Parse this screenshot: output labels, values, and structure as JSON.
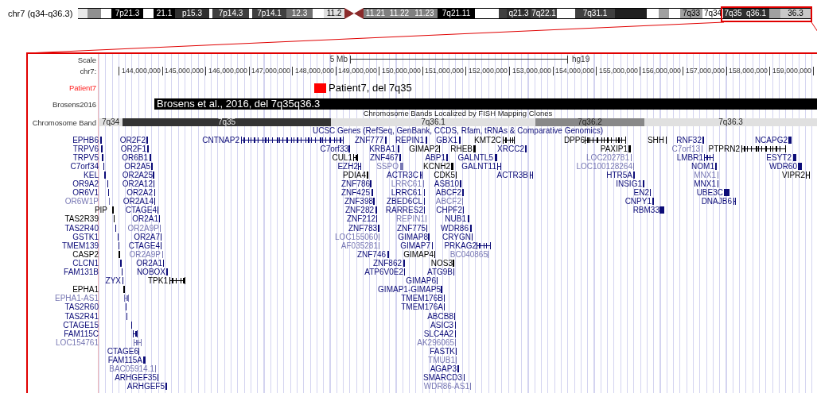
{
  "ideogram": {
    "title": "chr7 (q34-q36.3)",
    "bands": [
      {
        "kind": "band",
        "color": "#e8e8e8"
      },
      {
        "kind": "band",
        "color": "#909090"
      },
      {
        "kind": "band",
        "color": "#ffffff"
      },
      {
        "kind": "band",
        "label": "7p21.3",
        "color": "#000000"
      },
      {
        "kind": "band",
        "color": "#ffffff"
      },
      {
        "kind": "band",
        "label": "21.1",
        "color": "#000000"
      },
      {
        "kind": "band",
        "label": "p15.3",
        "color": "#303030"
      },
      {
        "kind": "band",
        "color": "#ffffff"
      },
      {
        "kind": "band",
        "label": "7p14.3",
        "color": "#404040"
      },
      {
        "kind": "band",
        "color": "#ffffff"
      },
      {
        "kind": "band",
        "label": "7p14.1",
        "color": "#404040"
      },
      {
        "kind": "band",
        "label": "12.3",
        "color": "#707070"
      },
      {
        "kind": "band",
        "color": "#ffffff"
      },
      {
        "kind": "band",
        "label": "11.2",
        "color": "#e0e0e0"
      },
      {
        "kind": "centromere",
        "color": "#8b2a2a"
      },
      {
        "kind": "band",
        "label": "11.21",
        "color": "#808080"
      },
      {
        "kind": "band",
        "label": "11.22",
        "color": "#808080"
      },
      {
        "kind": "band",
        "label": "11.23",
        "color": "#808080"
      },
      {
        "kind": "band",
        "label": "7q21.11",
        "color": "#000000"
      },
      {
        "kind": "band",
        "color": "#ffffff"
      },
      {
        "kind": "band",
        "color": "#404040"
      },
      {
        "kind": "band",
        "label": "q21.3",
        "color": "#303030"
      },
      {
        "kind": "band",
        "label": "7q22.1",
        "color": "#404040"
      },
      {
        "kind": "band",
        "color": "#ffffff"
      },
      {
        "kind": "band",
        "label": "7q31.1",
        "color": "#404040"
      },
      {
        "kind": "band",
        "color": "#202020"
      },
      {
        "kind": "band",
        "color": "#ffffff"
      },
      {
        "kind": "band",
        "color": "#a0a0a0"
      },
      {
        "kind": "band",
        "color": "#ffffff"
      },
      {
        "kind": "band",
        "label": "7q33",
        "color": "#a0a0a0"
      },
      {
        "kind": "band",
        "label": "7q34",
        "color": "#ffffff"
      },
      {
        "kind": "band",
        "label": "7q35",
        "color": "#303030"
      },
      {
        "kind": "band",
        "label": "q36.1",
        "color": "#303030"
      },
      {
        "kind": "band",
        "color": "#a0a0a0"
      },
      {
        "kind": "band",
        "label": "36.3",
        "color": "#c8c8c8"
      }
    ]
  },
  "scale": {
    "label": "Scale",
    "bar_label": "5 Mb",
    "assembly": "hg19"
  },
  "ruler": {
    "label": "chr7:",
    "ticks": [
      "144,000,000",
      "145,000,000",
      "146,000,000",
      "147,000,000",
      "148,000,000",
      "149,000,000",
      "150,000,000",
      "151,000,000",
      "152,000,000",
      "153,000,000",
      "154,000,000",
      "155,000,000",
      "156,000,000",
      "157,000,000",
      "158,000,000",
      "159,000,000"
    ]
  },
  "patient_track": {
    "label": "Patient7",
    "item": "Patient7, del 7q35"
  },
  "brosens_track": {
    "label": "Brosens2016",
    "item": "Brosens et al., 2016, del 7q35q36.3"
  },
  "band_track": {
    "title": "Chromosome Bands Localized by FISH Mapping Clones",
    "label": "Chromosome Band",
    "bands": [
      {
        "label": "7q34",
        "color": "#e0e0e0"
      },
      {
        "label": "7q35",
        "color": "#333333"
      },
      {
        "label": "7q36.1",
        "color": "#e0e0e0"
      },
      {
        "label": "7q36.2",
        "color": "#888888"
      },
      {
        "label": "7q36.3",
        "color": "#e0e0e0"
      }
    ]
  },
  "gene_track": {
    "title": "UCSC Genes (RefSeq, GenBank, CCDS, Rfam, tRNAs & Comparative Genomics)",
    "genes": [
      {
        "name": "EPHB6",
        "color": "#0c0c78"
      },
      {
        "name": "OR2F2",
        "color": "#0c0c78"
      },
      {
        "name": "CNTNAP2",
        "color": "#0c0c78"
      },
      {
        "name": "ZNF777",
        "color": "#0c0c78"
      },
      {
        "name": "REPIN1",
        "color": "#0c0c78"
      },
      {
        "name": "GBX1",
        "color": "#0c0c78"
      },
      {
        "name": "KMT2C",
        "color": "#000000"
      },
      {
        "name": "DPP6",
        "color": "#000000"
      },
      {
        "name": "SHH",
        "color": "#000000"
      },
      {
        "name": "RNF32",
        "color": "#0c0c78"
      },
      {
        "name": "NCAPG2",
        "color": "#0c0c78"
      },
      {
        "name": "TRPV6",
        "color": "#0c0c78"
      },
      {
        "name": "OR2F1",
        "color": "#0c0c78"
      },
      {
        "name": "C7orf33",
        "color": "#0c0c78"
      },
      {
        "name": "KRBA1",
        "color": "#0c0c78"
      },
      {
        "name": "GIMAP2",
        "color": "#000000"
      },
      {
        "name": "RHEB",
        "color": "#000000"
      },
      {
        "name": "XRCC2",
        "color": "#0c0c78"
      },
      {
        "name": "PAXIP1",
        "color": "#000000"
      },
      {
        "name": "C7orf13",
        "color": "#7878b4"
      },
      {
        "name": "PTPRN2",
        "color": "#000000"
      },
      {
        "name": "TRPV5",
        "color": "#0c0c78"
      },
      {
        "name": "OR6B1",
        "color": "#0c0c78"
      },
      {
        "name": "CUL1",
        "color": "#000000"
      },
      {
        "name": "ZNF467",
        "color": "#0c0c78"
      },
      {
        "name": "ABP1",
        "color": "#0c0c78"
      },
      {
        "name": "GALNTL5",
        "color": "#0c0c78"
      },
      {
        "name": "LOC202781",
        "color": "#7878b4"
      },
      {
        "name": "LMBR1",
        "color": "#0c0c78"
      },
      {
        "name": "ESYT2",
        "color": "#0c0c78"
      },
      {
        "name": "C7orf34",
        "color": "#0c0c78"
      },
      {
        "name": "OR2A5",
        "color": "#0c0c78"
      },
      {
        "name": "EZH2",
        "color": "#0c0c78"
      },
      {
        "name": "SSPO",
        "color": "#7878b4"
      },
      {
        "name": "KCNH2",
        "color": "#000000"
      },
      {
        "name": "GALNT11",
        "color": "#0c0c78"
      },
      {
        "name": "LOC100128264",
        "color": "#7878b4"
      },
      {
        "name": "NOM1",
        "color": "#0c0c78"
      },
      {
        "name": "WDR60",
        "color": "#0c0c78"
      },
      {
        "name": "KEL",
        "color": "#0c0c78"
      },
      {
        "name": "OR2A25",
        "color": "#0c0c78"
      },
      {
        "name": "PDIA4",
        "color": "#000000"
      },
      {
        "name": "ACTR3C",
        "color": "#0c0c78"
      },
      {
        "name": "CDK5",
        "color": "#000000"
      },
      {
        "name": "ACTR3B",
        "color": "#0c0c78"
      },
      {
        "name": "HTR5A",
        "color": "#0c0c78"
      },
      {
        "name": "MNX1",
        "color": "#7878b4"
      },
      {
        "name": "VIPR2",
        "color": "#000000"
      },
      {
        "name": "OR9A2",
        "color": "#0c0c78"
      },
      {
        "name": "OR2A12",
        "color": "#0c0c78"
      },
      {
        "name": "ZNF786",
        "color": "#0c0c78"
      },
      {
        "name": "LRRC61",
        "color": "#7878b4"
      },
      {
        "name": "ASB10",
        "color": "#0c0c78"
      },
      {
        "name": "INSIG1",
        "color": "#0c0c78"
      },
      {
        "name": "MNX1",
        "color": "#0c0c78"
      },
      {
        "name": "OR6V1",
        "color": "#0c0c78"
      },
      {
        "name": "OR2A2",
        "color": "#0c0c78"
      },
      {
        "name": "ZNF425",
        "color": "#0c0c78"
      },
      {
        "name": "LRRC61",
        "color": "#0c0c78"
      },
      {
        "name": "ABCF2",
        "color": "#0c0c78"
      },
      {
        "name": "EN2",
        "color": "#0c0c78"
      },
      {
        "name": "UBE3C",
        "color": "#0c0c78"
      },
      {
        "name": "OR6W1P",
        "color": "#7878b4"
      },
      {
        "name": "OR2A14",
        "color": "#0c0c78"
      },
      {
        "name": "ZNF398",
        "color": "#0c0c78"
      },
      {
        "name": "ZBED6CL",
        "color": "#0c0c78"
      },
      {
        "name": "ABCF2",
        "color": "#7878b4"
      },
      {
        "name": "CNPY1",
        "color": "#0c0c78"
      },
      {
        "name": "DNAJB6",
        "color": "#0c0c78"
      },
      {
        "name": "PIP",
        "color": "#000000"
      },
      {
        "name": "CTAGE4",
        "color": "#0c0c78"
      },
      {
        "name": "ZNF282",
        "color": "#0c0c78"
      },
      {
        "name": "RARRES2",
        "color": "#0c0c78"
      },
      {
        "name": "CHPF2",
        "color": "#0c0c78"
      },
      {
        "name": "RBM33",
        "color": "#0c0c78"
      },
      {
        "name": "TAS2R39",
        "color": "#000000"
      },
      {
        "name": "OR2A1",
        "color": "#0c0c78"
      },
      {
        "name": "ZNF212",
        "color": "#0c0c78"
      },
      {
        "name": "REPIN1",
        "color": "#7878b4"
      },
      {
        "name": "NUB1",
        "color": "#0c0c78"
      },
      {
        "name": "TAS2R40",
        "color": "#0c0c78"
      },
      {
        "name": "OR2A9P",
        "color": "#7878b4"
      },
      {
        "name": "ZNF783",
        "color": "#0c0c78"
      },
      {
        "name": "ZNF775",
        "color": "#0c0c78"
      },
      {
        "name": "WDR86",
        "color": "#0c0c78"
      },
      {
        "name": "GSTK1",
        "color": "#0c0c78"
      },
      {
        "name": "OR2A7",
        "color": "#0c0c78"
      },
      {
        "name": "LOC155060",
        "color": "#7878b4"
      },
      {
        "name": "GIMAP8",
        "color": "#0c0c78"
      },
      {
        "name": "CRYGN",
        "color": "#0c0c78"
      },
      {
        "name": "TMEM139",
        "color": "#0c0c78"
      },
      {
        "name": "CTAGE4",
        "color": "#0c0c78"
      },
      {
        "name": "AF035281",
        "color": "#7878b4"
      },
      {
        "name": "GIMAP7",
        "color": "#0c0c78"
      },
      {
        "name": "PRKAG2",
        "color": "#0c0c78"
      },
      {
        "name": "CASP2",
        "color": "#000000"
      },
      {
        "name": "OR2A9P",
        "color": "#7878b4"
      },
      {
        "name": "ZNF746",
        "color": "#0c0c78"
      },
      {
        "name": "GIMAP4",
        "color": "#000000"
      },
      {
        "name": "BC040865",
        "color": "#7878b4"
      },
      {
        "name": "CLCN1",
        "color": "#0c0c78"
      },
      {
        "name": "OR2A1",
        "color": "#0c0c78"
      },
      {
        "name": "ZNF862",
        "color": "#0c0c78"
      },
      {
        "name": "NOS3",
        "color": "#000000"
      },
      {
        "name": "FAM131B",
        "color": "#0c0c78"
      },
      {
        "name": "NOBOX",
        "color": "#0c0c78"
      },
      {
        "name": "ATP6V0E2",
        "color": "#0c0c78"
      },
      {
        "name": "ATG9B",
        "color": "#0c0c78"
      },
      {
        "name": "ZYX",
        "color": "#0c0c78"
      },
      {
        "name": "TPK1",
        "color": "#000000"
      },
      {
        "name": "GIMAP6",
        "color": "#0c0c78"
      },
      {
        "name": "EPHA1",
        "color": "#000000"
      },
      {
        "name": "GIMAP1-GIMAP5",
        "color": "#0c0c78"
      },
      {
        "name": "EPHA1-AS1",
        "color": "#7878b4"
      },
      {
        "name": "TMEM176B",
        "color": "#0c0c78"
      },
      {
        "name": "TAS2R60",
        "color": "#0c0c78"
      },
      {
        "name": "TMEM176A",
        "color": "#0c0c78"
      },
      {
        "name": "TAS2R41",
        "color": "#0c0c78"
      },
      {
        "name": "ABCB8",
        "color": "#0c0c78"
      },
      {
        "name": "CTAGE15",
        "color": "#0c0c78"
      },
      {
        "name": "ASIC3",
        "color": "#0c0c78"
      },
      {
        "name": "FAM115C",
        "color": "#0c0c78"
      },
      {
        "name": "SLC4A2",
        "color": "#0c0c78"
      },
      {
        "name": "LOC154761",
        "color": "#7878b4"
      },
      {
        "name": "AK296065",
        "color": "#7878b4"
      },
      {
        "name": "CTAGE6",
        "color": "#0c0c78"
      },
      {
        "name": "FASTK",
        "color": "#0c0c78"
      },
      {
        "name": "FAM115A",
        "color": "#0c0c78"
      },
      {
        "name": "TMUB1",
        "color": "#7878b4"
      },
      {
        "name": "BAC05914.1",
        "color": "#7878b4"
      },
      {
        "name": "AGAP3",
        "color": "#0c0c78"
      },
      {
        "name": "ARHGEF35",
        "color": "#0c0c78"
      },
      {
        "name": "SMARCD3",
        "color": "#0c0c78"
      },
      {
        "name": "ARHGEF5",
        "color": "#0c0c78"
      },
      {
        "name": "WDR86-AS1",
        "color": "#7878b4"
      }
    ]
  }
}
